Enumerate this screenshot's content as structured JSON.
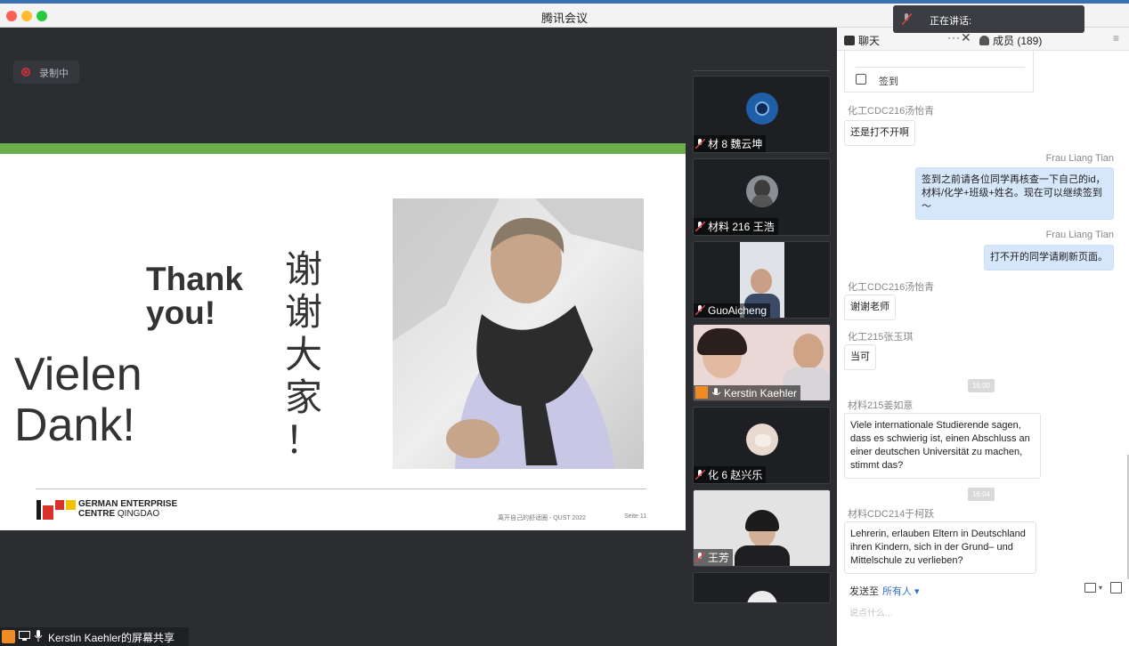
{
  "window": {
    "title": "腾讯会议"
  },
  "recording": {
    "label": "录制中"
  },
  "slide": {
    "thank_you_line1": "Thank",
    "thank_you_line2": "you!",
    "vielen_line1": "Vielen",
    "vielen_line2": "Dank!",
    "chinese_chars": [
      "谢",
      "谢",
      "大",
      "家",
      "！"
    ],
    "logo_line1": "GERMAN ENTERPRISE",
    "logo_line2a": "CENTRE",
    "logo_line2b": "QINGDAO",
    "footer": "离开自己的舒适圈 - QUST 2022",
    "page": "Seite  11",
    "logo_colors": [
      "#1a1a1a",
      "#d9302c",
      "#f2c200"
    ]
  },
  "screen_share": {
    "label": "Kerstin Kaehler的屏幕共享"
  },
  "participants": [
    {
      "name": "材 8 魏云坤",
      "muted": true
    },
    {
      "name": "材料 216 王浩",
      "muted": true
    },
    {
      "name": "GuoAicheng",
      "muted": true
    },
    {
      "name": "Kerstin Kaehler",
      "muted": false,
      "host": true
    },
    {
      "name": "化 6 赵兴乐",
      "muted": true
    },
    {
      "name": "王芳",
      "muted": true
    }
  ],
  "speaking": {
    "label": "正在讲话:"
  },
  "panel": {
    "tab_chat": "聊天",
    "tab_more": "···",
    "tab_members": "成员 (189)"
  },
  "signin": {
    "label": "签到"
  },
  "messages": [
    {
      "sender": "化工CDC216汤怡青",
      "text": "还是打不开啊",
      "side": "left"
    },
    {
      "sender": "Frau Liang Tian",
      "text_line1": "签到之前请各位同学再核查一下自己的id，",
      "text_line2": "材料/化学+班级+姓名。现在可以继续签到～",
      "side": "right"
    },
    {
      "sender": "Frau Liang Tian",
      "text": "打不开的同学请刷新页面。",
      "side": "right"
    },
    {
      "sender": "化工CDC216汤怡青",
      "text": "谢谢老师",
      "side": "left"
    },
    {
      "sender": "化工215张玉琪",
      "text": "当可",
      "side": "left"
    },
    {
      "time": "16:00"
    },
    {
      "sender": "材料215姜如意",
      "lines": [
        "Viele internationale Studierende sagen,",
        "dass es schwierig ist, einen Abschluss an",
        "einer deutschen Universität zu machen,",
        "stimmt das?"
      ],
      "side": "left"
    },
    {
      "time": "16:04"
    },
    {
      "sender": "材料CDC214于柯跃",
      "lines": [
        "Lehrerin, erlauben Eltern in Deutschland",
        "ihren Kindern, sich in der Grund– und",
        "Mittelschule zu verlieben?"
      ],
      "side": "left"
    }
  ],
  "composer": {
    "send_to_label": "发送至",
    "send_to_target": "所有人 ▾",
    "placeholder": "说点什么..."
  },
  "colors": {
    "accent_blue": "#2f6fd1",
    "slide_green": "#6cae4c",
    "record_red": "#c8303a",
    "host_orange": "#f08a24"
  }
}
